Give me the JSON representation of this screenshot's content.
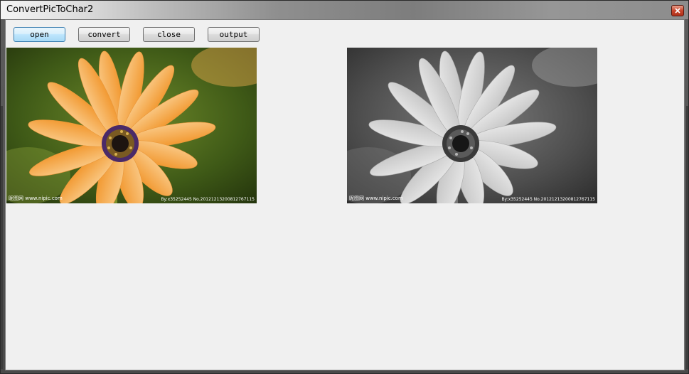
{
  "window": {
    "title": "ConvertPicToChar2",
    "close_icon": "close-icon"
  },
  "toolbar": {
    "open_label": "open",
    "convert_label": "convert",
    "close_label": "close",
    "output_label": "output"
  },
  "images": {
    "original": {
      "description_icon": "flower-photo-color",
      "watermark_left": "昵图网 www.nipic.com",
      "watermark_right": "By:x35252445  No.20121213200812767115"
    },
    "converted": {
      "description_icon": "flower-photo-grayscale",
      "watermark_left": "昵图网 www.nipic.com",
      "watermark_right": "By:x35252445  No.20121213200812767115"
    }
  },
  "colors": {
    "client_bg": "#f0f0f0",
    "petal_orange": "#f6b15a",
    "focus_blue": "#3c7fb1"
  }
}
